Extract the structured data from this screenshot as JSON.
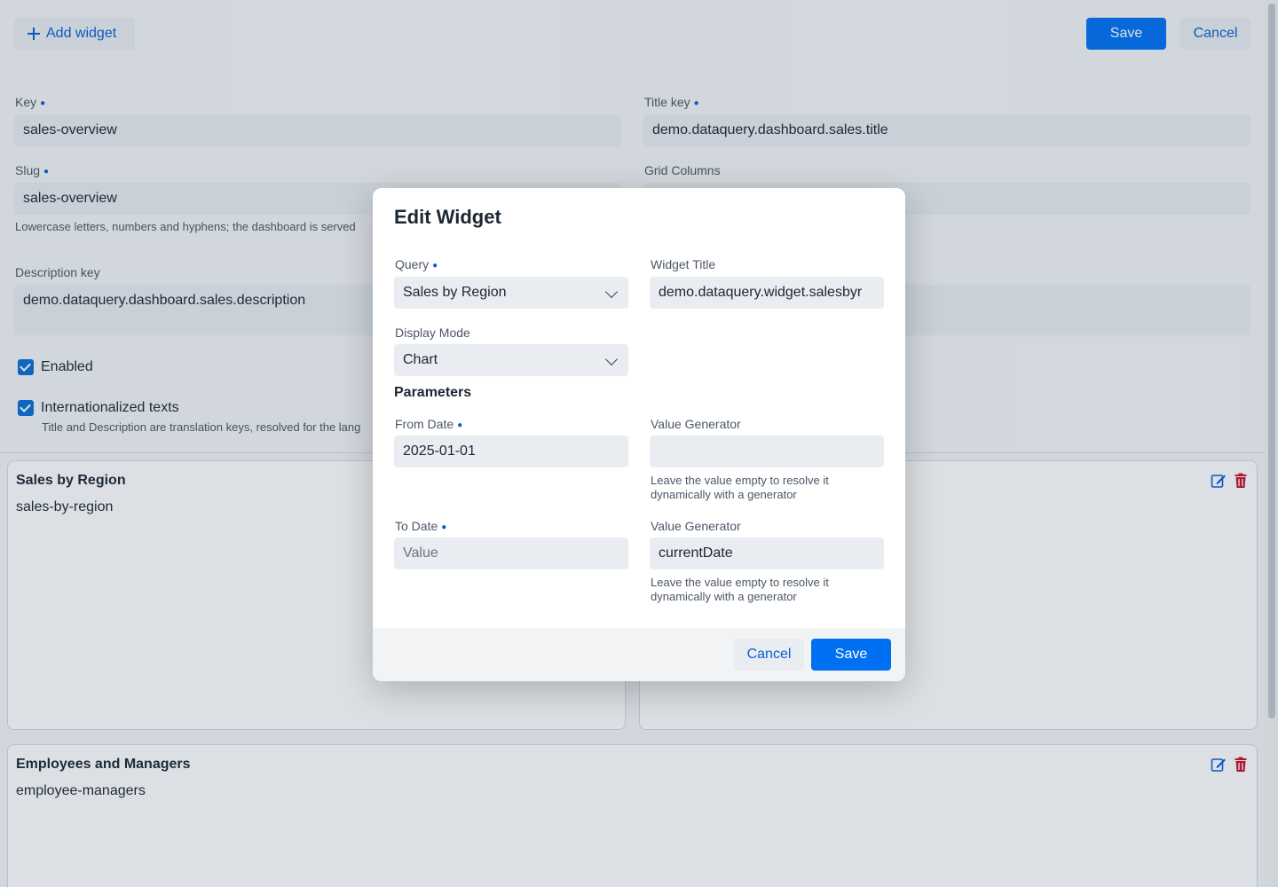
{
  "toolbar": {
    "add_widget_label": "Add widget",
    "save_label": "Save",
    "cancel_label": "Cancel"
  },
  "form": {
    "key": {
      "label": "Key",
      "value": "sales-overview"
    },
    "title_key": {
      "label": "Title key",
      "value": "demo.dataquery.dashboard.sales.title"
    },
    "slug": {
      "label": "Slug",
      "value": "sales-overview",
      "hint": "Lowercase letters, numbers and hyphens; the dashboard is served"
    },
    "grid_columns": {
      "label": "Grid Columns"
    },
    "description_key": {
      "label": "Description key",
      "value": "demo.dataquery.dashboard.sales.description"
    },
    "enabled": {
      "label": "Enabled",
      "checked": true
    },
    "i18n": {
      "label": "Internationalized texts",
      "checked": true,
      "hint": "Title and Description are translation keys, resolved for the lang"
    }
  },
  "widgets": [
    {
      "title": "Sales by Region",
      "slug": "sales-by-region"
    },
    {
      "title": "Employees and Managers",
      "slug": "employee-managers"
    }
  ],
  "dialog": {
    "title": "Edit Widget",
    "query": {
      "label": "Query",
      "value": "Sales by Region"
    },
    "widget_title": {
      "label": "Widget Title",
      "value": "demo.dataquery.widget.salesbyr"
    },
    "display_mode": {
      "label": "Display Mode",
      "value": "Chart"
    },
    "parameters_heading": "Parameters",
    "from_date": {
      "label": "From Date",
      "value": "2025-01-01",
      "generator_label": "Value Generator",
      "generator_value": "",
      "generator_hint": "Leave the value empty to resolve it dynamically with a generator"
    },
    "to_date": {
      "label": "To Date",
      "placeholder": "Value",
      "generator_label": "Value Generator",
      "generator_value": "currentDate",
      "generator_hint": "Leave the value empty to resolve it dynamically with a generator"
    },
    "cancel_label": "Cancel",
    "save_label": "Save"
  },
  "colors": {
    "primary": "#0070f2",
    "link": "#0a5fd6",
    "danger": "#c8102e"
  }
}
